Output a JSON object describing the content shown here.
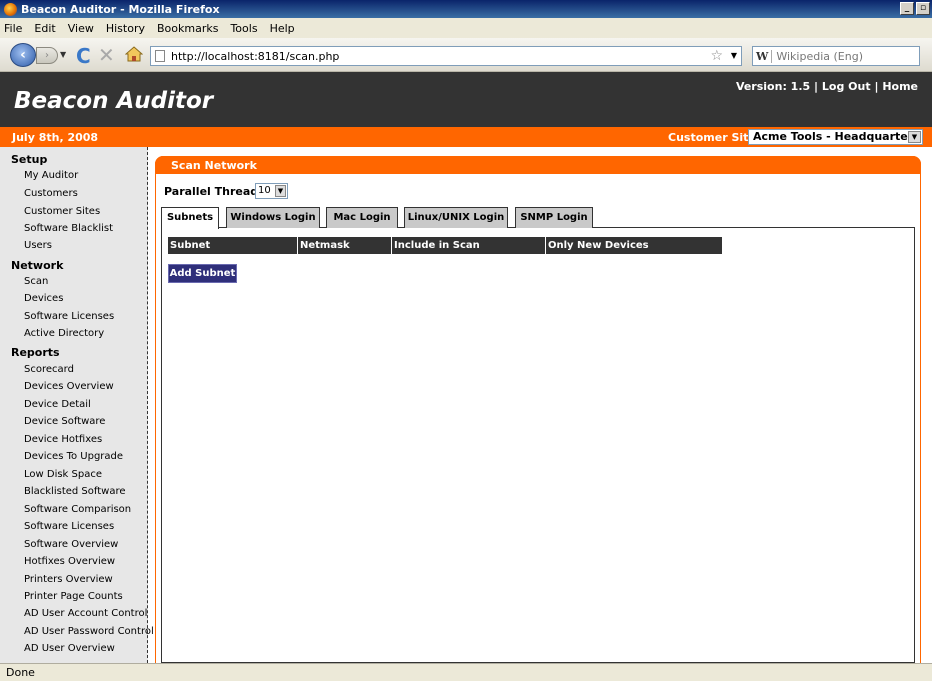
{
  "window": {
    "title": "Beacon Auditor - Mozilla Firefox"
  },
  "menu": [
    "File",
    "Edit",
    "View",
    "History",
    "Bookmarks",
    "Tools",
    "Help"
  ],
  "nav": {
    "url": "http://localhost:8181/scan.php",
    "search_placeholder": "Wikipedia (Eng)",
    "search_engine_glyph": "W"
  },
  "header": {
    "app_title": "Beacon Auditor",
    "version": "Version: 1.5",
    "sep1": "|",
    "logout": "Log Out",
    "sep2": "|",
    "home": "Home"
  },
  "datebar": {
    "date": "July 8th, 2008",
    "site_label": "Customer Site:",
    "site_value": "Acme Tools - Headquarters"
  },
  "sidebar": {
    "setup": {
      "heading": "Setup",
      "items": [
        "My Auditor",
        "Customers",
        "Customer Sites",
        "Software Blacklist",
        "Users"
      ]
    },
    "network": {
      "heading": "Network",
      "items": [
        "Scan",
        "Devices",
        "Software Licenses",
        "Active Directory"
      ]
    },
    "reports": {
      "heading": "Reports",
      "items": [
        "Scorecard",
        "Devices Overview",
        "Device Detail",
        "Device Software",
        "Device Hotfixes",
        "Devices To Upgrade",
        "Low Disk Space",
        "Blacklisted Software",
        "Software Comparison",
        "Software Licenses",
        "Software Overview",
        "Hotfixes Overview",
        "Printers Overview",
        "Printer Page Counts",
        "AD User Account Control",
        "AD User Password Control",
        "AD User Overview"
      ]
    }
  },
  "panel": {
    "title": "Scan Network",
    "threads_label": "Parallel Threads:",
    "threads_value": "10",
    "tabs": [
      "Subnets",
      "Windows Login",
      "Mac Login",
      "Linux/UNIX Login",
      "SNMP Login"
    ],
    "columns": [
      "Subnet",
      "Netmask",
      "Include in Scan",
      "Only New Devices"
    ],
    "add_button": "Add Subnet"
  },
  "status": "Done",
  "colors": {
    "accent": "#ff6600",
    "header_bg": "#333333",
    "button_bg": "#2f2f7a"
  },
  "icons": [
    "firefox-icon",
    "back-icon",
    "forward-icon",
    "reload-icon",
    "stop-icon",
    "home-icon",
    "page-icon",
    "star-icon",
    "search-icon"
  ]
}
